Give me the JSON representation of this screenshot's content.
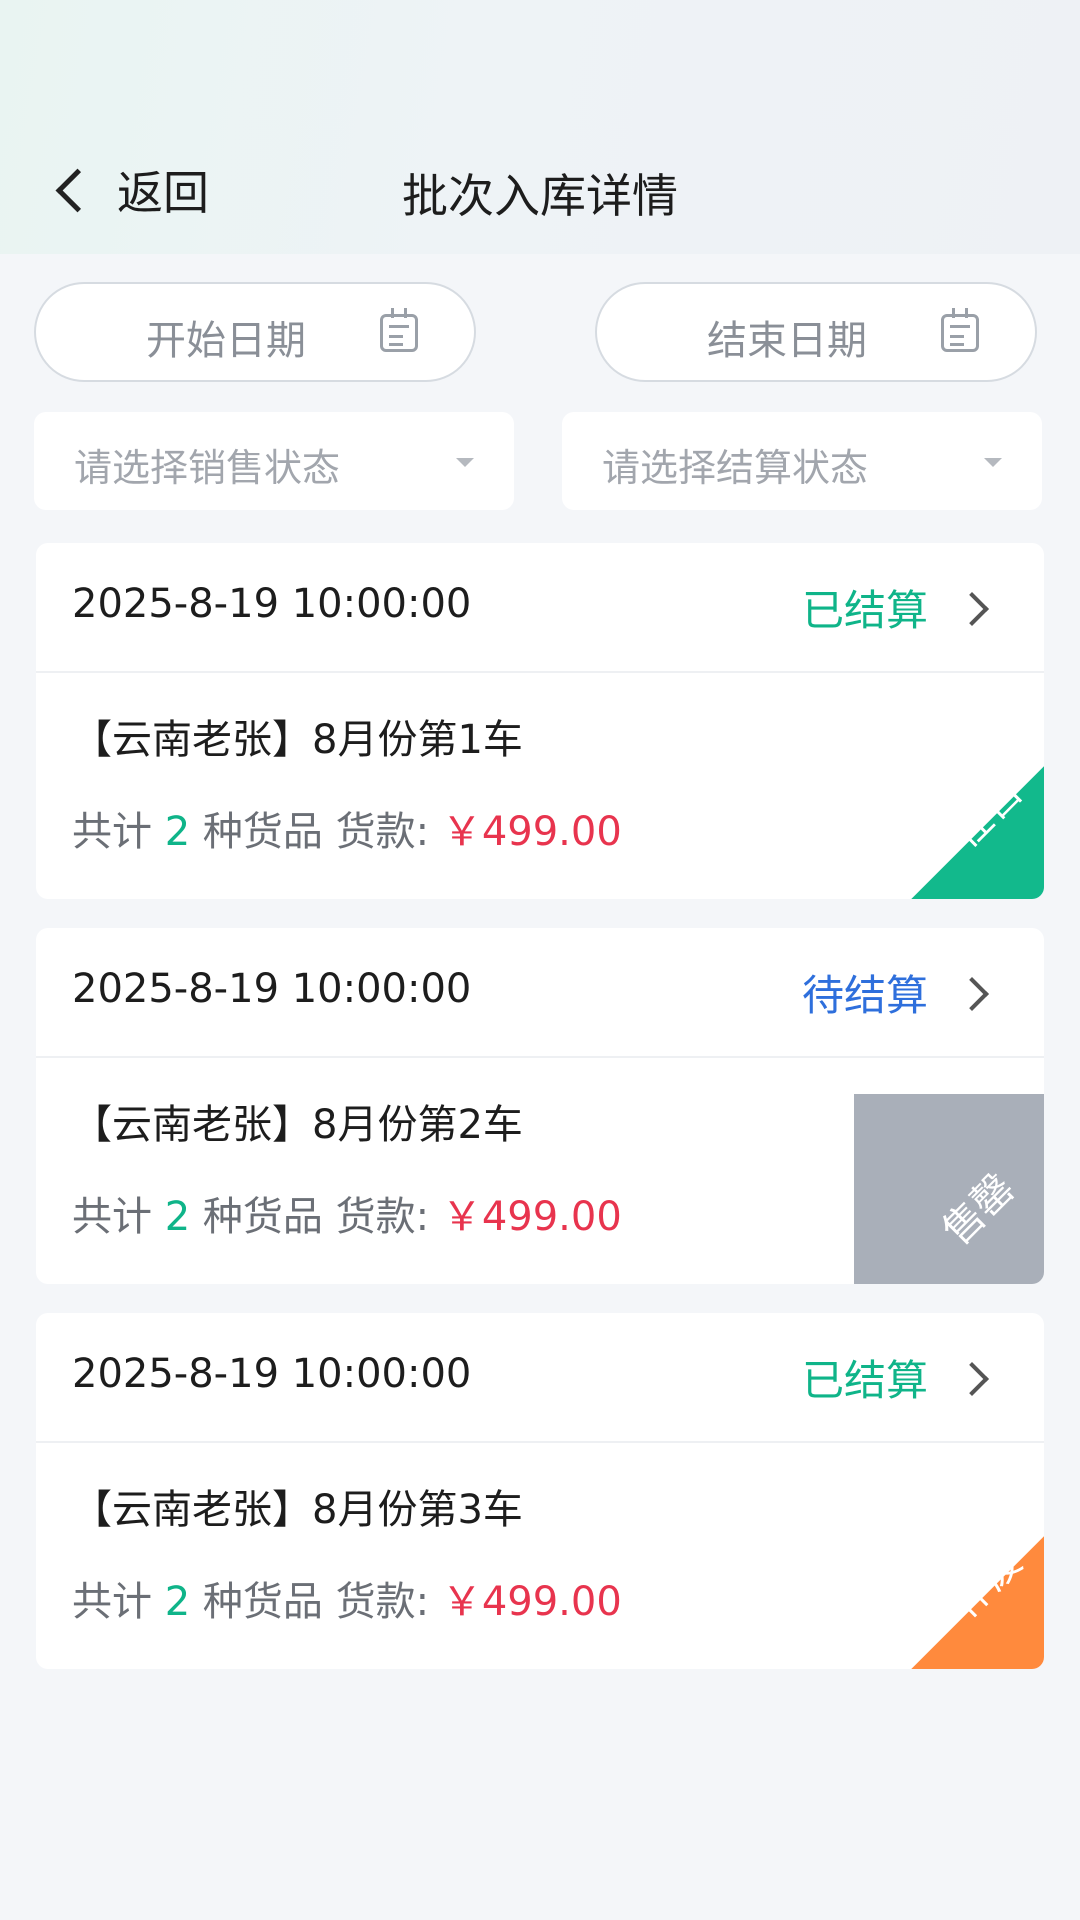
{
  "header": {
    "back_label": "返回",
    "title": "批次入库详情"
  },
  "filters": {
    "start_date_placeholder": "开始日期",
    "end_date_placeholder": "结束日期",
    "sale_status_placeholder": "请选择销售状态",
    "settle_status_placeholder": "请选择结算状态"
  },
  "labels": {
    "total_prefix": "共计",
    "kinds_suffix": "种货品",
    "payment_label": "货款:",
    "currency": "￥"
  },
  "colors": {
    "settled": "#0fb489",
    "pending": "#2e6fdc",
    "on_sale": "#12b98c",
    "sold_out": "#a9afb9",
    "void": "#ff8a3d",
    "amount": "#e8344e"
  },
  "batches": [
    {
      "time": "2025-8-19 10:00:00",
      "settle_status": "已结算",
      "name": "【云南老张】8月份第1车",
      "count": "2",
      "amount": "499.00",
      "sale_badge": "在售"
    },
    {
      "time": "2025-8-19 10:00:00",
      "settle_status": "待结算",
      "name": "【云南老张】8月份第2车",
      "count": "2",
      "amount": "499.00",
      "sale_badge": "售罄"
    },
    {
      "time": "2025-8-19 10:00:00",
      "settle_status": "已结算",
      "name": "【云南老张】8月份第3车",
      "count": "2",
      "amount": "499.00",
      "sale_badge": "作废"
    }
  ]
}
